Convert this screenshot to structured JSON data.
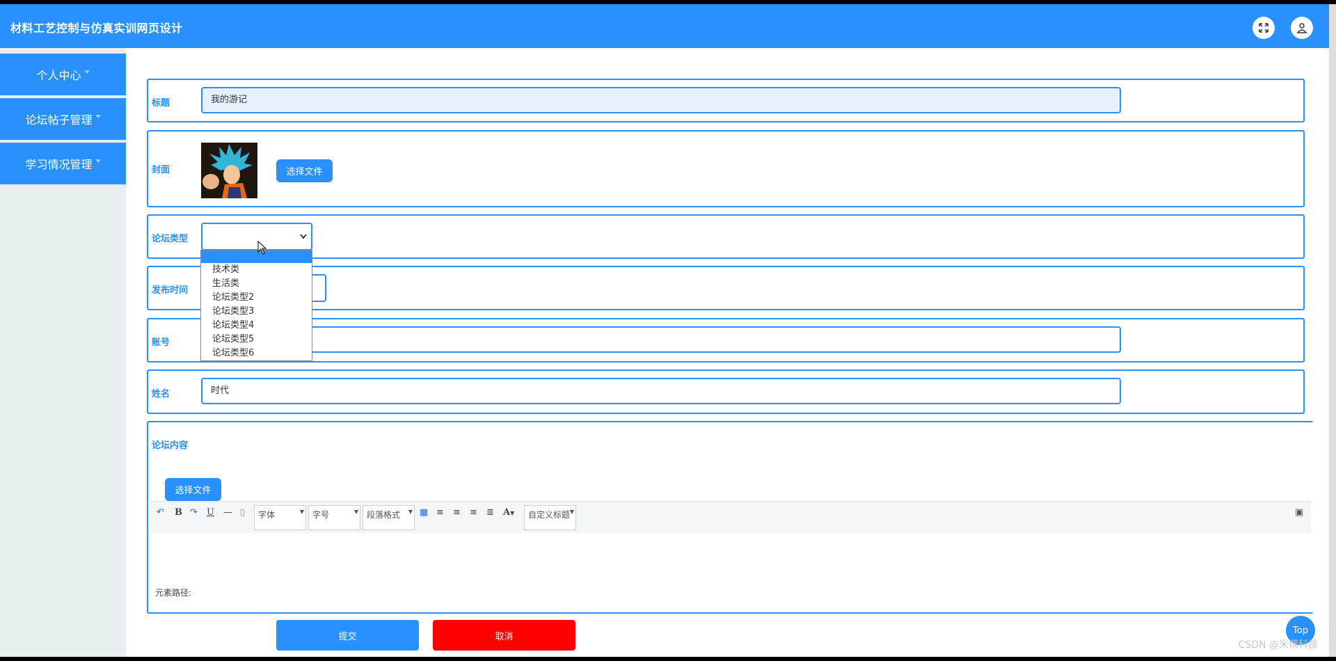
{
  "header": {
    "title": "材料工艺控制与仿真实训网页设计"
  },
  "sidebar": {
    "items": [
      {
        "label": "个人中心"
      },
      {
        "label": "论坛帖子管理"
      },
      {
        "label": "学习情况管理"
      }
    ]
  },
  "form": {
    "title_label": "标题",
    "title_value": "我的游记",
    "cover_label": "封面",
    "cover_button": "选择文件",
    "type_label": "论坛类型",
    "type_value": "",
    "type_options": [
      "",
      "技术类",
      "生活类",
      "论坛类型2",
      "论坛类型3",
      "论坛类型4",
      "论坛类型5",
      "论坛类型6"
    ],
    "time_label": "发布时间",
    "account_label": "账号",
    "account_value": "",
    "name_label": "姓名",
    "name_value": "时代",
    "content_label": "论坛内容",
    "content_button": "选择文件",
    "editor": {
      "font": "字体",
      "size": "字号",
      "format": "段落格式",
      "custom_title": "自定义标题",
      "font_color_glyph": "A",
      "path_label": "元素路径:"
    },
    "submit": "提交",
    "cancel": "取消"
  },
  "top_button": "Top",
  "watermark": "CSDN @米偶科技",
  "colors": {
    "primary": "#2891fe",
    "cancel": "#ff0000"
  }
}
